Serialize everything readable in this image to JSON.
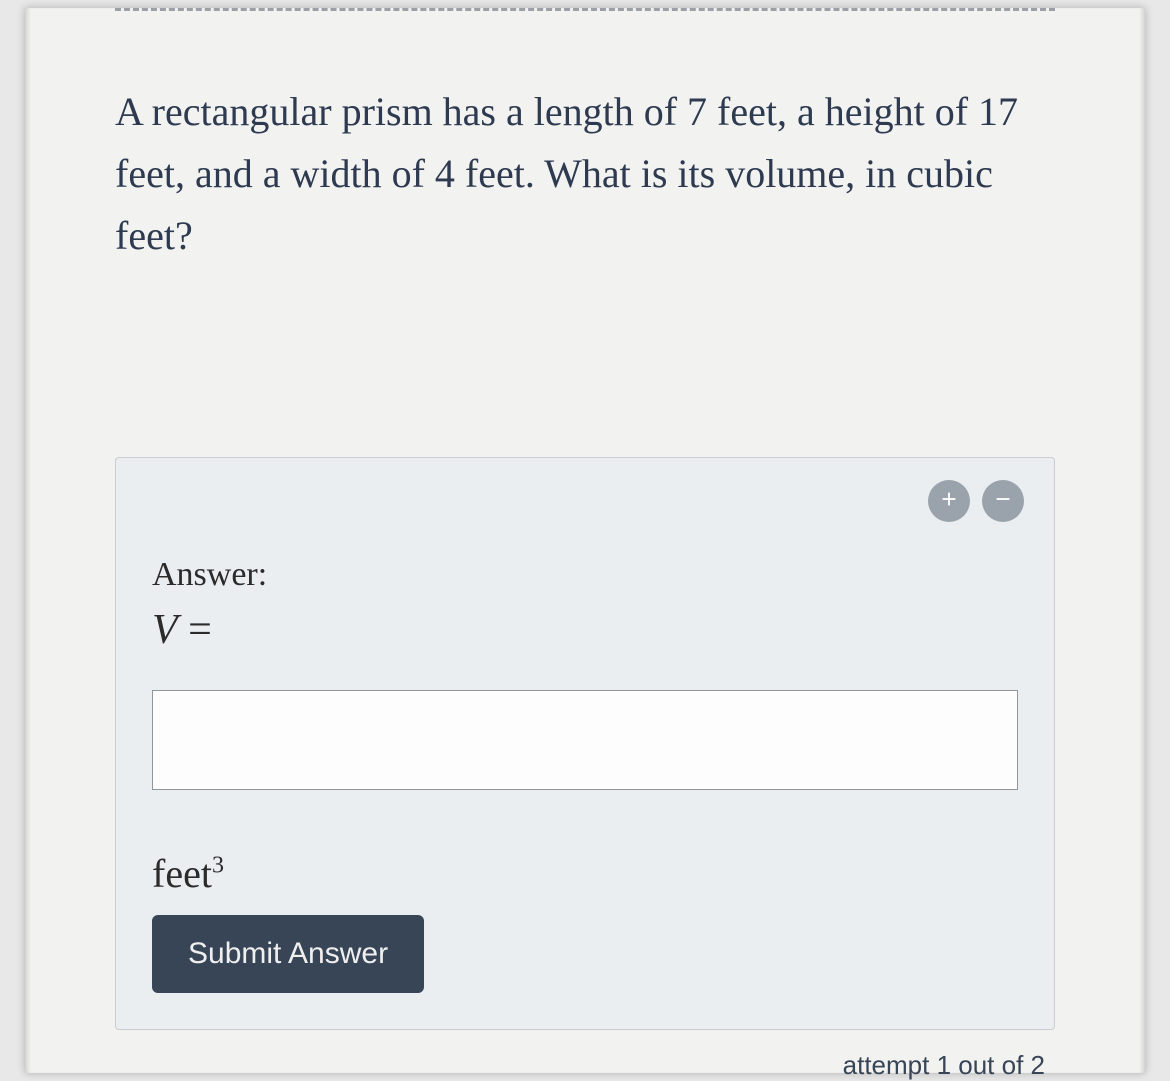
{
  "question": "A rectangular prism has a length of 7 feet, a height of 17 feet, and a width of 4 feet. What is its volume, in cubic feet?",
  "answer_box": {
    "label": "Answer:",
    "equation_var": "V",
    "equation_equals": "=",
    "input_value": "",
    "units_base": "feet",
    "units_exp": "3",
    "submit_label": "Submit Answer"
  },
  "attempt_text": "attempt 1 out of 2"
}
